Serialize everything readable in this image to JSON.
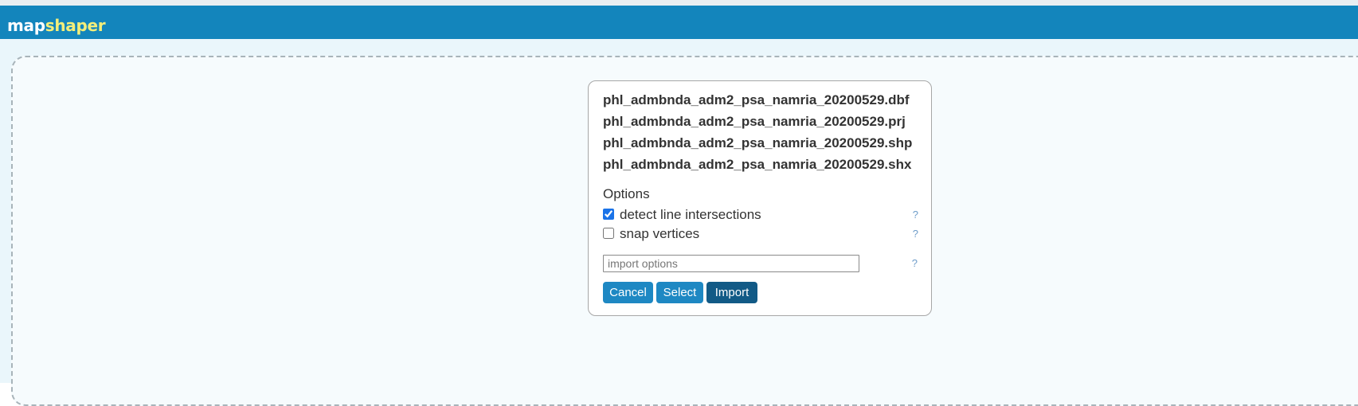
{
  "app": {
    "logo_part1": "map",
    "logo_part2": "shaper"
  },
  "import_dialog": {
    "files": [
      "phl_admbnda_adm2_psa_namria_20200529.dbf",
      "phl_admbnda_adm2_psa_namria_20200529.prj",
      "phl_admbnda_adm2_psa_namria_20200529.shp",
      "phl_admbnda_adm2_psa_namria_20200529.shx"
    ],
    "options_title": "Options",
    "options": [
      {
        "label": "detect line intersections",
        "checked": true,
        "help": "?"
      },
      {
        "label": "snap vertices",
        "checked": false,
        "help": "?"
      }
    ],
    "import_options": {
      "placeholder": "import options",
      "value": "",
      "help": "?"
    },
    "buttons": {
      "cancel": "Cancel",
      "select": "Select",
      "import": "Import"
    }
  },
  "colors": {
    "header": "#1385bc",
    "logo_accent": "#f3ee7a",
    "button": "#1e88c3",
    "button_primary": "#125a86",
    "stage_bg": "#eaf6fb"
  }
}
